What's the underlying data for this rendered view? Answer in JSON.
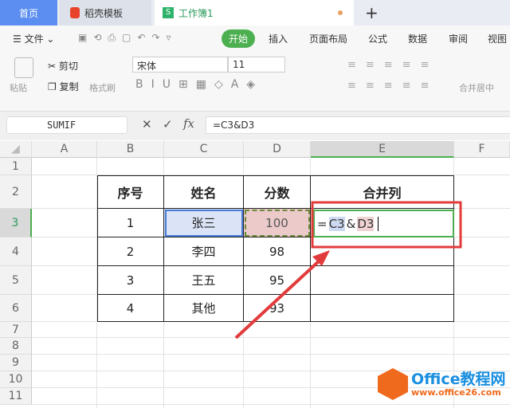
{
  "tabs": [
    {
      "label": "首页"
    },
    {
      "label": "稻壳模板"
    },
    {
      "label": "工作簿1"
    }
  ],
  "tab_add": "+",
  "menu": {
    "file": "文件",
    "items": [
      "开始",
      "插入",
      "页面布局",
      "公式",
      "数据",
      "审阅",
      "视图"
    ]
  },
  "ribbon": {
    "paste": "粘贴",
    "cut": "剪切",
    "copy": "复制",
    "format_painter": "格式刷",
    "font": "宋体",
    "font_size": "11",
    "merge": "合并居中"
  },
  "formula_bar": {
    "name_box": "SUMIF",
    "formula": "=C3&D3",
    "fx": "fx"
  },
  "columns": [
    "A",
    "B",
    "C",
    "D",
    "E",
    "F"
  ],
  "rows": [
    "1",
    "2",
    "3",
    "4",
    "5",
    "6",
    "7",
    "8",
    "9",
    "10",
    "11"
  ],
  "table": {
    "headers": [
      "序号",
      "姓名",
      "分数",
      "合并列"
    ],
    "rows": [
      [
        "1",
        "张三",
        "100",
        ""
      ],
      [
        "2",
        "李四",
        "98",
        ""
      ],
      [
        "3",
        "王五",
        "95",
        ""
      ],
      [
        "4",
        "其他",
        "93",
        ""
      ]
    ]
  },
  "edit_cell": {
    "eq": "=",
    "ref1": "C3",
    "amp": "&",
    "ref2": "D3"
  },
  "watermark": {
    "title": "Office教程网",
    "url": "www.office26.com"
  },
  "colors": {
    "accent": "#4caf50",
    "home_tab": "#5b8ef0",
    "annotation": "#e23b3b",
    "watermark": "#f06a1d"
  }
}
